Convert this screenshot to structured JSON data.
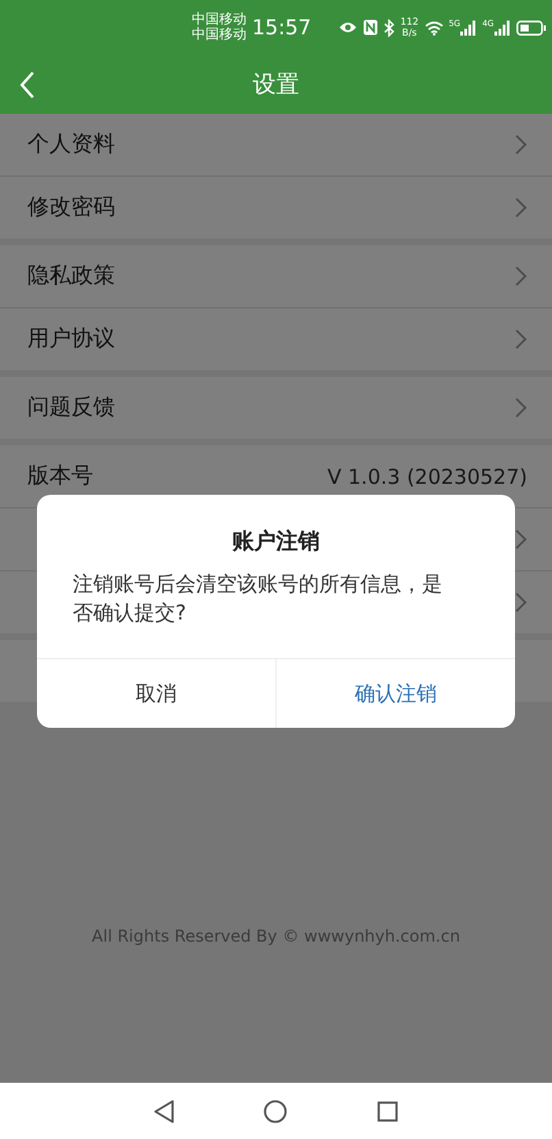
{
  "status_bar": {
    "carriers": [
      "中国移动",
      "中国移动"
    ],
    "time": "15:57",
    "net_speed": [
      "112",
      "B/s"
    ],
    "signals": [
      {
        "label": "5G"
      },
      {
        "label": "4G"
      }
    ]
  },
  "header": {
    "title": "设置"
  },
  "groups": [
    [
      {
        "kind": "link",
        "label": "个人资料"
      },
      {
        "kind": "link",
        "label": "修改密码"
      }
    ],
    [
      {
        "kind": "link",
        "label": "隐私政策"
      },
      {
        "kind": "link",
        "label": "用户协议"
      }
    ],
    [
      {
        "kind": "link",
        "label": "问题反馈"
      }
    ],
    [
      {
        "kind": "info",
        "label": "版本号",
        "value": "V 1.0.3 (20230527)"
      },
      {
        "kind": "link"
      },
      {
        "kind": "link"
      }
    ],
    [
      {
        "kind": "blank"
      }
    ]
  ],
  "footer": "All Rights Reserved By © wwwynhyh.com.cn",
  "dialog": {
    "title": "账户注销",
    "message": "注销账号后会清空该账号的所有信息，是否确认提交?",
    "buttons": [
      {
        "kind": "cancel",
        "label": "取消"
      },
      {
        "kind": "confirm",
        "label": "确认注销"
      }
    ]
  }
}
